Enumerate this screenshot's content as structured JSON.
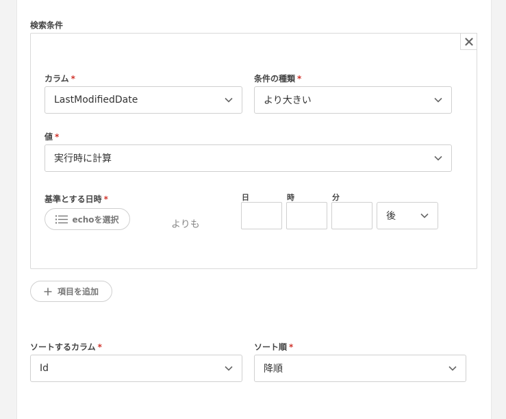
{
  "search": {
    "section_title": "検索条件"
  },
  "condition": {
    "column_label": "カラム",
    "column_value": "LastModifiedDate",
    "type_label": "条件の種類",
    "type_value": "より大きい",
    "value_label": "値",
    "value_value": "実行時に計算",
    "base_date_label": "基準とする日時",
    "echo_select_label": "echoを選択",
    "relative_text": "よりも",
    "day_label": "日",
    "hour_label": "時",
    "minute_label": "分",
    "day_value": "",
    "hour_value": "",
    "minute_value": "",
    "direction_value": "後"
  },
  "add_item_label": "項目を追加",
  "sort": {
    "column_label": "ソートするカラム",
    "column_value": "Id",
    "order_label": "ソート順",
    "order_value": "降順"
  },
  "required_mark": "*",
  "icons": [
    "close-icon",
    "chevron-down-icon",
    "list-icon",
    "plus-icon"
  ],
  "colors": {
    "required": "#d0342c",
    "border": "#cfcfcf",
    "text": "#333333"
  }
}
